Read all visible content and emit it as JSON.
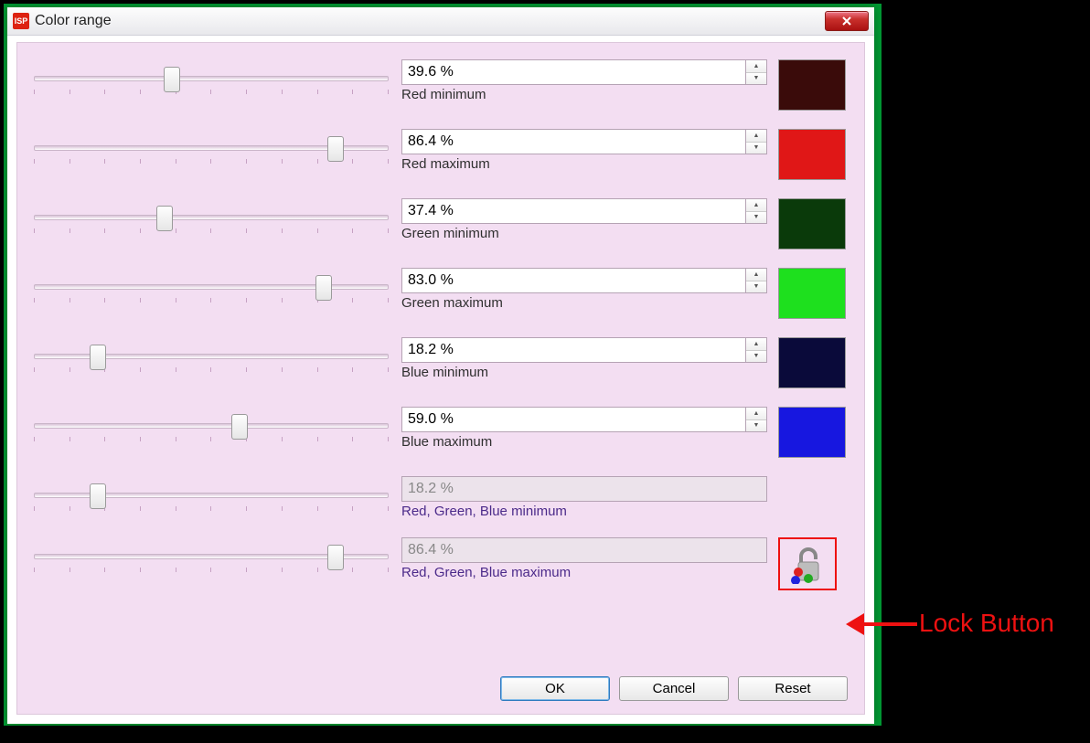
{
  "window": {
    "title": "Color range",
    "app_icon_text": "ISP"
  },
  "sliders": [
    {
      "name": "red-min",
      "value": "39.6 %",
      "label": "Red minimum",
      "pos": 39.6,
      "swatch": "#3a0b0a",
      "disabled": false,
      "spinner": true
    },
    {
      "name": "red-max",
      "value": "86.4 %",
      "label": "Red maximum",
      "pos": 86.4,
      "swatch": "#e01717",
      "disabled": false,
      "spinner": true
    },
    {
      "name": "green-min",
      "value": "37.4 %",
      "label": "Green minimum",
      "pos": 37.4,
      "swatch": "#0a3a0a",
      "disabled": false,
      "spinner": true
    },
    {
      "name": "green-max",
      "value": "83.0 %",
      "label": "Green maximum",
      "pos": 83.0,
      "swatch": "#1ee01e",
      "disabled": false,
      "spinner": true
    },
    {
      "name": "blue-min",
      "value": "18.2 %",
      "label": "Blue minimum",
      "pos": 18.2,
      "swatch": "#0a0a3a",
      "disabled": false,
      "spinner": true
    },
    {
      "name": "blue-max",
      "value": "59.0 %",
      "label": "Blue maximum",
      "pos": 59.0,
      "swatch": "#1717e0",
      "disabled": false,
      "spinner": true
    },
    {
      "name": "rgb-min",
      "value": "18.2 %",
      "label": "Red, Green, Blue minimum",
      "pos": 18.2,
      "swatch": null,
      "disabled": true,
      "spinner": false
    },
    {
      "name": "rgb-max",
      "value": "86.4 %",
      "label": "Red, Green, Blue maximum",
      "pos": 86.4,
      "swatch": null,
      "disabled": true,
      "spinner": false
    }
  ],
  "buttons": {
    "ok": "OK",
    "cancel": "Cancel",
    "reset": "Reset"
  },
  "annotation": {
    "label": "Lock Button"
  }
}
